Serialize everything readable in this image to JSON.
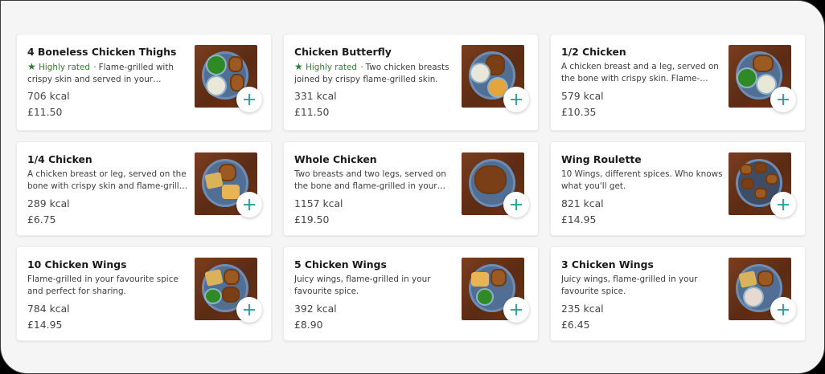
{
  "menu": {
    "items": [
      {
        "title": "4 Boneless Chicken Thighs",
        "rated": "Highly rated",
        "separator": "·",
        "desc": "Flame-grilled with crispy skin and served in your favourite spice.",
        "kcal": "706 kcal",
        "price": "£11.50",
        "image": "chicken-thighs-plate-image"
      },
      {
        "title": "Chicken Butterfly",
        "rated": "Highly rated",
        "separator": "·",
        "desc": "Two chicken breasts joined by crispy flame-grilled skin.",
        "kcal": "331 kcal",
        "price": "£11.50",
        "image": "chicken-butterfly-plate-image"
      },
      {
        "title": "1/2 Chicken",
        "rated": "",
        "separator": "",
        "desc": "A chicken breast and a leg, served on the bone with crispy skin. Flame-grilled in your favourite spice.",
        "kcal": "579 kcal",
        "price": "£10.35",
        "image": "half-chicken-plate-image"
      },
      {
        "title": "1/4 Chicken",
        "rated": "",
        "separator": "",
        "desc": "A chicken breast or leg, served on the bone with crispy skin and flame-grilled in your favourite spice.",
        "kcal": "289 kcal",
        "price": "£6.75",
        "image": "quarter-chicken-plate-image"
      },
      {
        "title": "Whole Chicken",
        "rated": "",
        "separator": "",
        "desc": "Two breasts and two legs, served on the bone and flame-grilled in your favourite spice.",
        "kcal": "1157 kcal",
        "price": "£19.50",
        "image": "whole-chicken-plate-image"
      },
      {
        "title": "Wing Roulette",
        "rated": "",
        "separator": "",
        "desc": "10 Wings, different spices. Who knows what you'll get.",
        "kcal": "821 kcal",
        "price": "£14.95",
        "image": "wing-roulette-plate-image"
      },
      {
        "title": "10 Chicken Wings",
        "rated": "",
        "separator": "",
        "desc": "Flame-grilled in your favourite spice and perfect for sharing.",
        "kcal": "784 kcal",
        "price": "£14.95",
        "image": "ten-wings-plate-image"
      },
      {
        "title": "5 Chicken Wings",
        "rated": "",
        "separator": "",
        "desc": "Juicy wings, flame-grilled in your favourite spice.",
        "kcal": "392 kcal",
        "price": "£8.90",
        "image": "five-wings-plate-image"
      },
      {
        "title": "3 Chicken Wings",
        "rated": "",
        "separator": "",
        "desc": "Juicy wings, flame-grilled in your favourite spice.",
        "kcal": "235 kcal",
        "price": "£6.45",
        "image": "three-wings-plate-image"
      }
    ]
  },
  "icons": {
    "add": "plus-icon",
    "rating": "star-icon"
  },
  "colors": {
    "accent": "#1a9e8f",
    "rated": "#2f7d32",
    "card": "#ffffff",
    "background": "#f5f5f5"
  }
}
